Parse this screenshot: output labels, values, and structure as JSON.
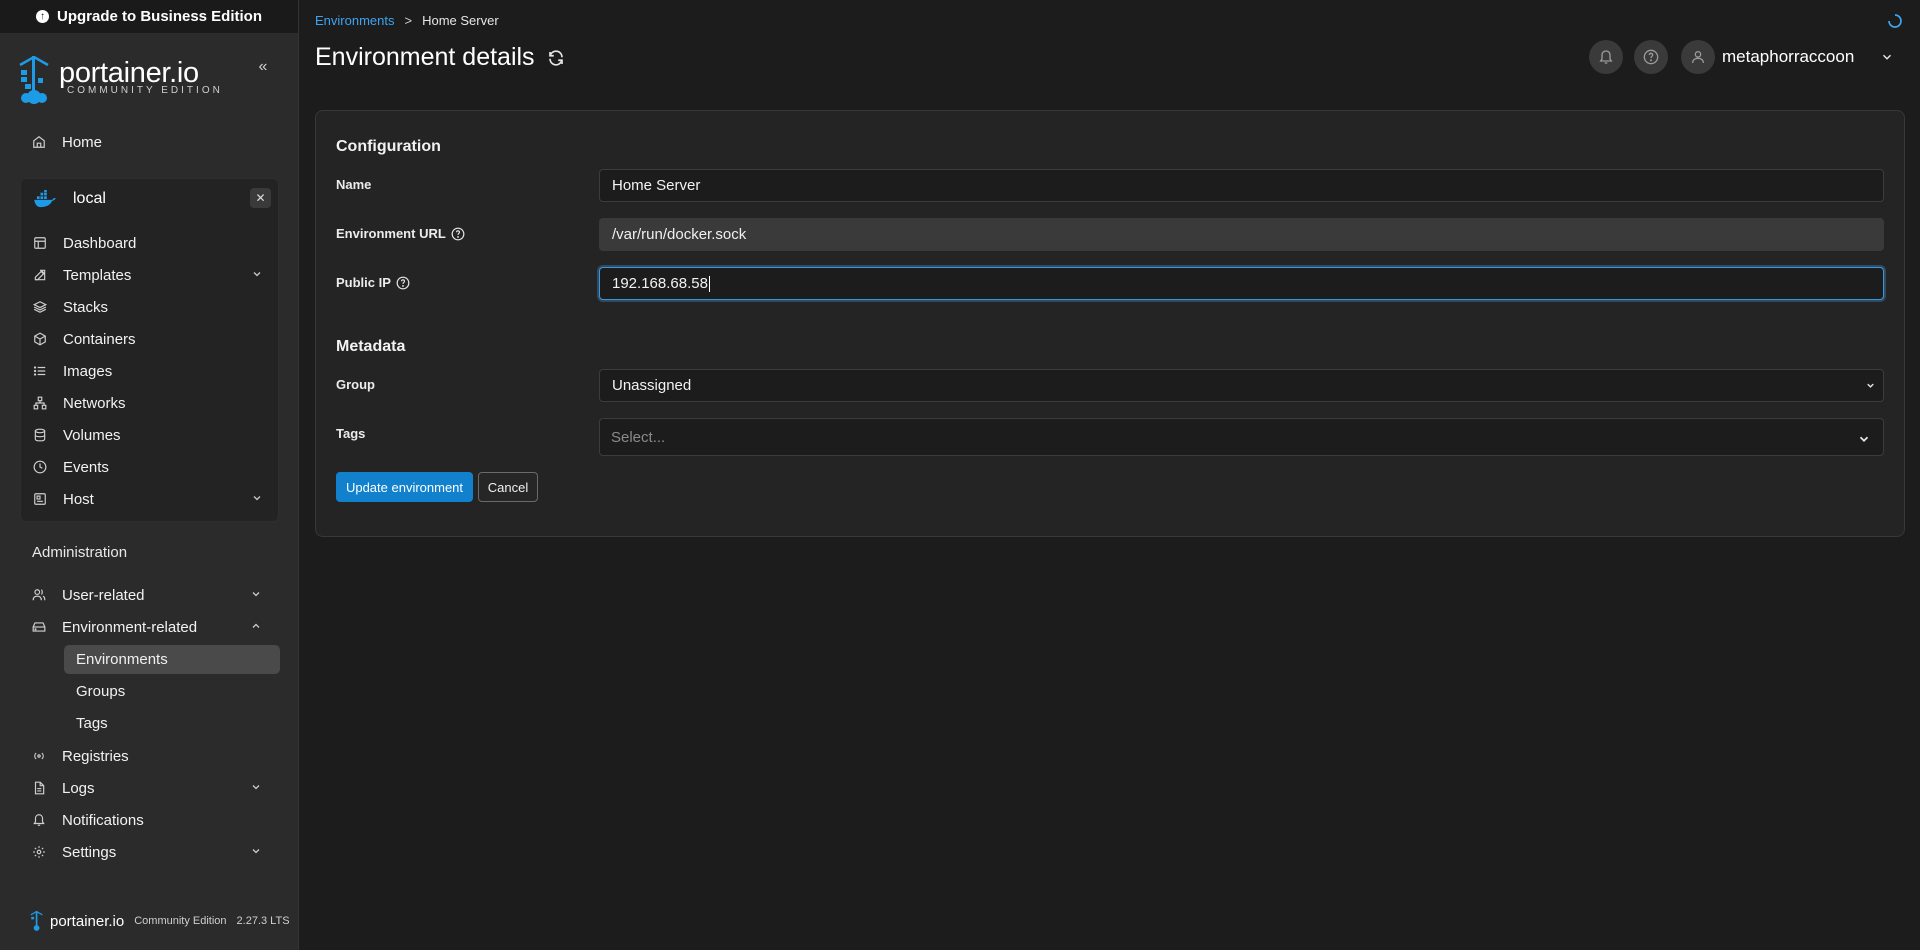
{
  "banner": {
    "upgrade_label": "Upgrade to Business Edition"
  },
  "logo": {
    "name": "portainer.io",
    "subtitle": "COMMUNITY EDITION"
  },
  "sidebar": {
    "home": "Home",
    "environment": {
      "name": "local",
      "items": [
        {
          "label": "Dashboard",
          "icon": "dashboard-icon"
        },
        {
          "label": "Templates",
          "icon": "templates-icon",
          "expandable": true
        },
        {
          "label": "Stacks",
          "icon": "stacks-icon"
        },
        {
          "label": "Containers",
          "icon": "containers-icon"
        },
        {
          "label": "Images",
          "icon": "images-icon"
        },
        {
          "label": "Networks",
          "icon": "networks-icon"
        },
        {
          "label": "Volumes",
          "icon": "volumes-icon"
        },
        {
          "label": "Events",
          "icon": "events-icon"
        },
        {
          "label": "Host",
          "icon": "host-icon",
          "expandable": true
        }
      ]
    },
    "admin_label": "Administration",
    "admin_items": {
      "user_related": "User-related",
      "environment_related": "Environment-related",
      "sub_items": [
        "Environments",
        "Groups",
        "Tags"
      ],
      "registries": "Registries",
      "logs": "Logs",
      "notifications": "Notifications",
      "settings": "Settings"
    },
    "footer": {
      "name": "portainer.io",
      "edition": "Community Edition",
      "version": "2.27.3 LTS"
    }
  },
  "header": {
    "breadcrumb": {
      "link": "Environments",
      "separator": ">",
      "current": "Home Server"
    },
    "title": "Environment details",
    "username": "metaphorraccoon"
  },
  "form": {
    "configuration_title": "Configuration",
    "name_label": "Name",
    "name_value": "Home Server",
    "url_label": "Environment URL",
    "url_value": "/var/run/docker.sock",
    "public_ip_label": "Public IP",
    "public_ip_value": "192.168.68.58",
    "metadata_title": "Metadata",
    "group_label": "Group",
    "group_value": "Unassigned",
    "tags_label": "Tags",
    "tags_placeholder": "Select...",
    "update_button": "Update environment",
    "cancel_button": "Cancel"
  },
  "colors": {
    "accent": "#1181ce",
    "link": "#3ea4f0",
    "docker_blue": "#1d9be6"
  }
}
